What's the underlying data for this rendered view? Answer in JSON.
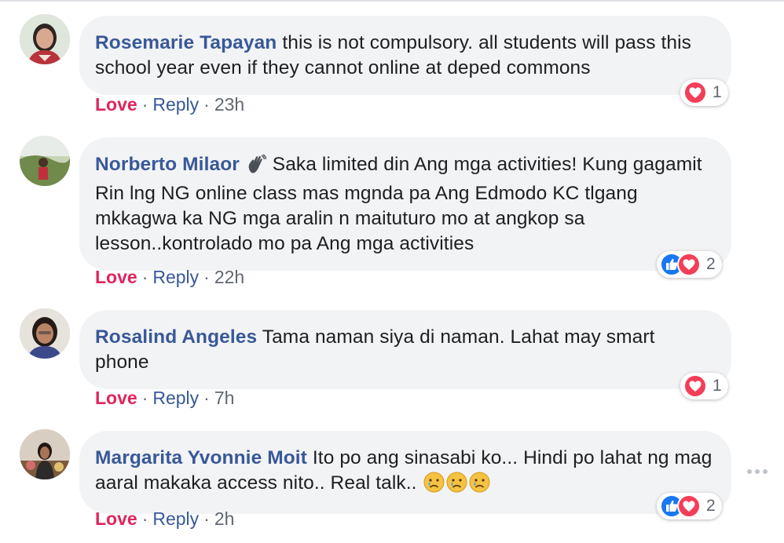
{
  "comments": [
    {
      "author": "Rosemarie Tapayan",
      "text": "this is not compulsory. all students will pass this school year even if they cannot online at deped commons",
      "love_label": "Love",
      "reply_label": "Reply",
      "separator": "·",
      "time": "23h",
      "reactions": [
        "love"
      ],
      "reaction_count": "1"
    },
    {
      "author": "Norberto Milaor",
      "author_emoji": "waving-hand",
      "text": "Saka limited din Ang mga activities! Kung gagamit Rin lng NG online class mas mgnda pa Ang Edmodo KC tlgang mkkagwa ka NG mga aralin n maituturo mo at angkop sa lesson..kontrolado mo pa Ang mga activities",
      "love_label": "Love",
      "reply_label": "Reply",
      "separator": "·",
      "time": "22h",
      "reactions": [
        "like",
        "love"
      ],
      "reaction_count": "2"
    },
    {
      "author": "Rosalind Angeles",
      "text": "Tama naman siya di naman. Lahat may smart phone",
      "love_label": "Love",
      "reply_label": "Reply",
      "separator": "·",
      "time": "7h",
      "reactions": [
        "love"
      ],
      "reaction_count": "1"
    },
    {
      "author": "Margarita Yvonnie Moit",
      "text": "Ito po ang sinasabi ko... Hindi po lahat ng mag aaral makaka access nito.. Real talk..",
      "trailing_emojis": [
        "crying-face",
        "crying-face",
        "crying-face"
      ],
      "love_label": "Love",
      "reply_label": "Reply",
      "separator": "·",
      "time": "2h",
      "reactions": [
        "like",
        "love"
      ],
      "reaction_count": "2"
    }
  ],
  "colors": {
    "author": "#385898",
    "love_action": "#e0245e",
    "bubble": "#f2f3f5",
    "meta": "#606770",
    "like_blue": "#1877f2",
    "love_red": "#f33e58"
  },
  "icons": {
    "more": "more-options-icon",
    "like": "like-reaction-icon",
    "love": "love-reaction-icon"
  }
}
